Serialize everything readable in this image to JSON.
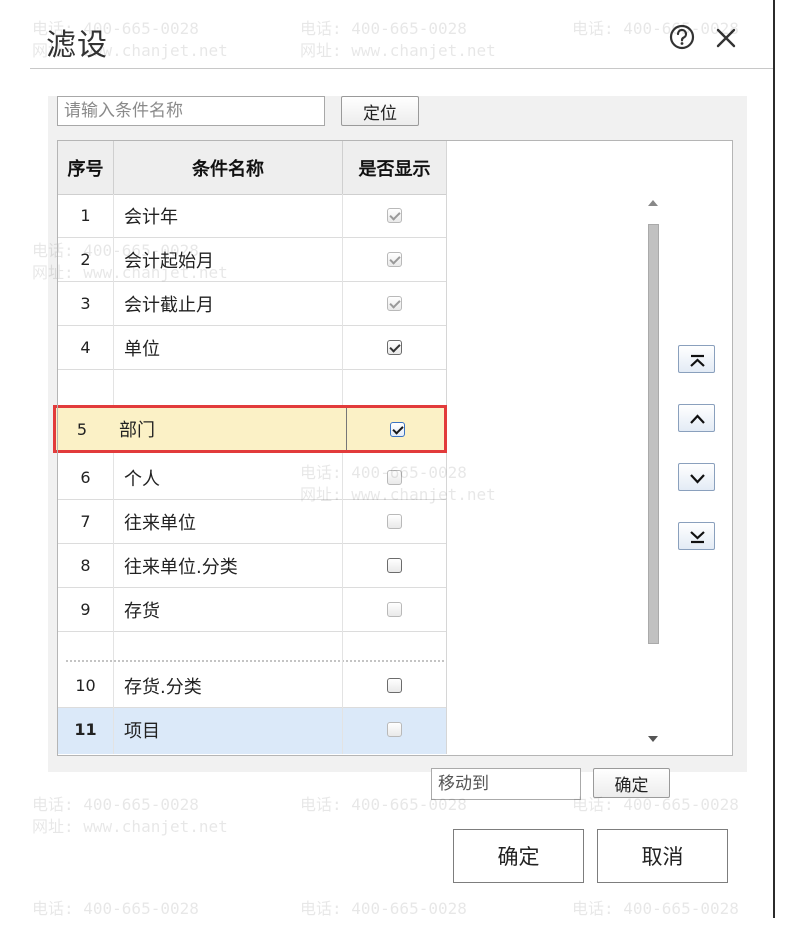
{
  "dialog": {
    "title": "滤设",
    "help_icon": "help-circle-icon",
    "close_icon": "close-x-icon"
  },
  "search": {
    "placeholder": "请输入条件名称",
    "locate_label": "定位"
  },
  "table": {
    "headers": {
      "seq": "序号",
      "name": "条件名称",
      "show": "是否显示"
    },
    "rows": [
      {
        "seq": "1",
        "name": "会计年",
        "show": true
      },
      {
        "seq": "2",
        "name": "会计起始月",
        "show": true
      },
      {
        "seq": "3",
        "name": "会计截止月",
        "show": true
      },
      {
        "seq": "4",
        "name": "单位",
        "show": true
      },
      {
        "seq": "5",
        "name": "部门",
        "show": true,
        "selected": true
      },
      {
        "seq": "6",
        "name": "个人",
        "show": false
      },
      {
        "seq": "7",
        "name": "往来单位",
        "show": false
      },
      {
        "seq": "8",
        "name": "往来单位.分类",
        "show": false
      },
      {
        "seq": "9",
        "name": "存货",
        "show": false
      },
      {
        "seq": "10",
        "name": "存货.分类",
        "show": false
      },
      {
        "seq": "11",
        "name": "项目",
        "show": false
      }
    ]
  },
  "move_buttons": {
    "top_icon": "move-to-top-icon",
    "up_icon": "move-up-icon",
    "down_icon": "move-down-icon",
    "bottom_icon": "move-to-bottom-icon"
  },
  "move_to": {
    "placeholder": "移动到",
    "confirm_label": "确定"
  },
  "footer": {
    "ok_label": "确定",
    "cancel_label": "取消"
  },
  "watermark": {
    "phone": "电话: 400-665-0028",
    "site": "网址: www.chanjet.net"
  },
  "colors": {
    "selection_border": "#e23b3b",
    "selection_fill": "#fbf1c6",
    "hover_row": "#dbe9f9",
    "move_button_border": "#8aa0bd"
  }
}
